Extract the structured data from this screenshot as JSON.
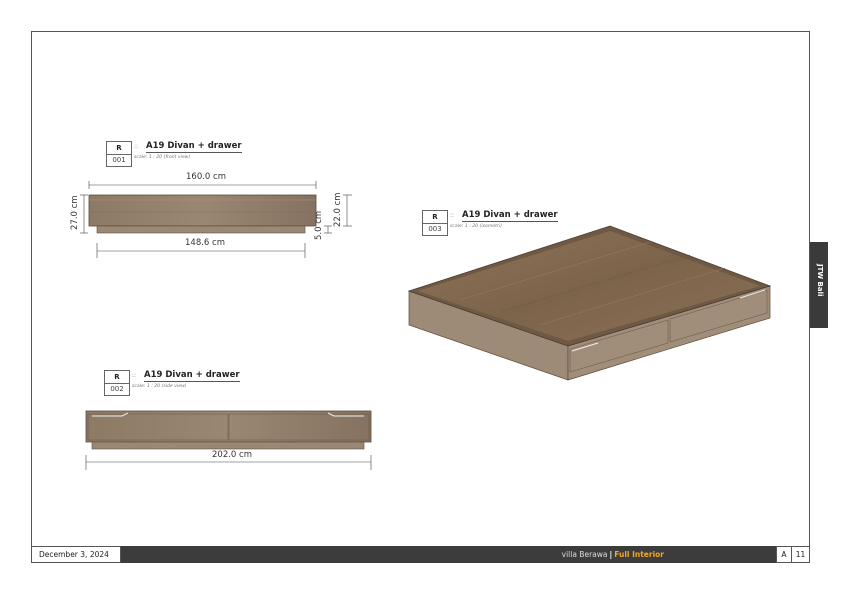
{
  "views": [
    {
      "code": "R",
      "number": "001",
      "title": "A19 Divan + drawer",
      "scale": "scale: 1 : 20 (front view)"
    },
    {
      "code": "R",
      "number": "002",
      "title": "A19 Divan + drawer",
      "scale": "scale: 1 : 20 (side view)"
    },
    {
      "code": "R",
      "number": "003",
      "title": "A19 Divan + drawer",
      "scale": "scale: 1 : 20 (isometri)"
    }
  ],
  "dimensions": {
    "front_width": "160.0 cm",
    "front_base_width": "148.6 cm",
    "front_height": "27.0 cm",
    "front_inner_height": "22.0 cm",
    "front_plinth_height": "5.0 cm",
    "side_length": "202.0 cm"
  },
  "sidetab": {
    "label": "JTW Bali"
  },
  "footer": {
    "date": "December 3, 2024",
    "project": "villa Berawa",
    "section": "Full Interior",
    "sheet_letter": "A",
    "page": "11"
  },
  "separator": "::",
  "colors": {
    "wood": "#8a7762",
    "wood_dark": "#6e5d4b",
    "footer_bar": "#3c3c3c",
    "accent": "#f5a623"
  }
}
